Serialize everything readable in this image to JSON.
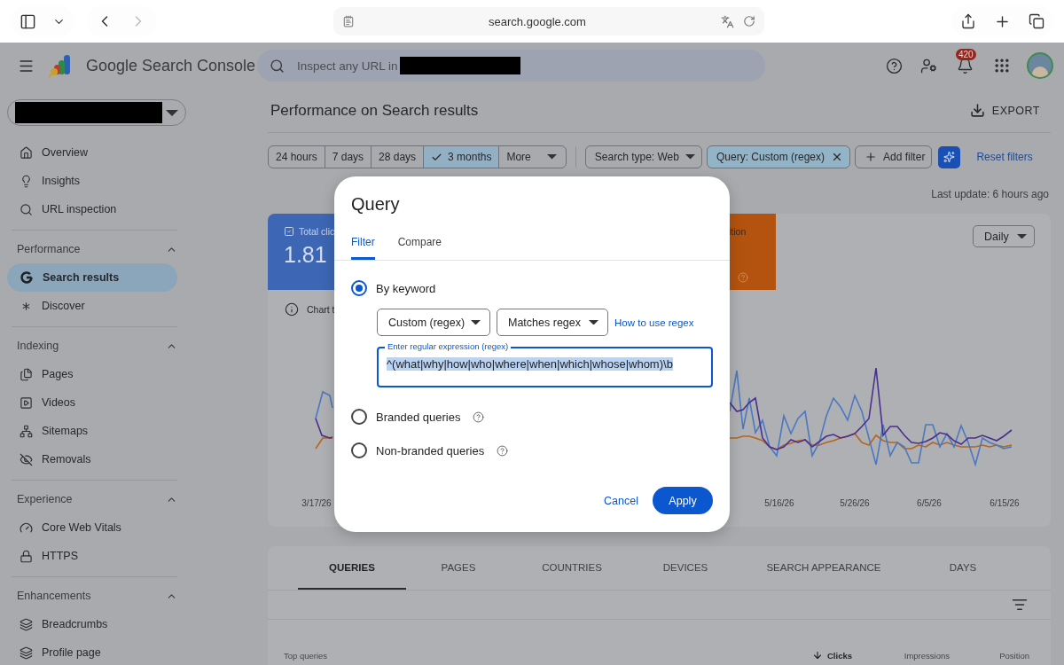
{
  "browser": {
    "address": "search.google.com",
    "back_disabled": false,
    "forward_disabled": true
  },
  "app": {
    "title": "Google Search Console",
    "search_placeholder": "Inspect any URL in",
    "notification_count": "420"
  },
  "sidebar": {
    "items": [
      {
        "kind": "overview",
        "label": "Overview",
        "selected": false
      },
      {
        "kind": "insights",
        "label": "Insights",
        "selected": false
      },
      {
        "kind": "inspect",
        "label": "URL inspection",
        "selected": false
      }
    ],
    "sections": [
      {
        "title": "Performance",
        "expanded": true,
        "items": [
          {
            "kind": "google",
            "label": "Search results",
            "selected": true
          },
          {
            "kind": "discover",
            "label": "Discover",
            "selected": false
          }
        ]
      },
      {
        "title": "Indexing",
        "expanded": true,
        "items": [
          {
            "kind": "pages",
            "label": "Pages",
            "selected": false
          },
          {
            "kind": "videos",
            "label": "Videos",
            "selected": false
          },
          {
            "kind": "sitemaps",
            "label": "Sitemaps",
            "selected": false
          },
          {
            "kind": "removals",
            "label": "Removals",
            "selected": false
          }
        ]
      },
      {
        "title": "Experience",
        "expanded": true,
        "items": [
          {
            "kind": "vitals",
            "label": "Core Web Vitals",
            "selected": false
          },
          {
            "kind": "https",
            "label": "HTTPS",
            "selected": false
          }
        ]
      },
      {
        "title": "Enhancements",
        "expanded": true,
        "items": [
          {
            "kind": "breadcrumbs",
            "label": "Breadcrumbs",
            "selected": false
          },
          {
            "kind": "profile",
            "label": "Profile page",
            "selected": false
          }
        ]
      }
    ]
  },
  "page": {
    "title": "Performance on Search results",
    "export": "EXPORT",
    "last_update": "Last update: 6 hours ago"
  },
  "date_ranges": [
    {
      "label": "24 hours",
      "selected": false
    },
    {
      "label": "7 days",
      "selected": false
    },
    {
      "label": "28 days",
      "selected": false
    },
    {
      "label": "3 months",
      "selected": true
    }
  ],
  "more": "More",
  "filters": [
    {
      "kind": "dropdown",
      "label": "Search type: Web",
      "active": false
    },
    {
      "kind": "removable",
      "label": "Query: Custom (regex)",
      "active": true
    },
    {
      "kind": "add",
      "label": "Add filter",
      "active": false
    }
  ],
  "reset_filters": "Reset filters",
  "chart": {
    "metric_cards": [
      {
        "label": "Total clic",
        "value": "1.81",
        "checked": true,
        "color": "#3d66b4"
      },
      {
        "label": "ition",
        "help": true,
        "color": "#b4530f"
      }
    ],
    "interval": "Daily",
    "info_text": "Chart t",
    "x_labels": [
      {
        "label": "3/17/26"
      },
      {
        "label": "5/16/26"
      },
      {
        "label": "5/26/26"
      },
      {
        "label": "6/5/26"
      },
      {
        "label": "6/15/26"
      }
    ]
  },
  "dialog": {
    "title": "Query",
    "tabs": [
      {
        "label": "Filter",
        "selected": true
      },
      {
        "label": "Compare",
        "selected": false
      }
    ],
    "options": [
      {
        "label": "By keyword",
        "selected": true,
        "help": false
      },
      {
        "label": "Branded queries",
        "selected": false,
        "help": true
      },
      {
        "label": "Non-branded queries",
        "selected": false,
        "help": true
      }
    ],
    "selects": [
      "Custom (regex)",
      "Matches regex"
    ],
    "regex_link": "How to use regex",
    "field": {
      "label": "Enter regular expression (regex)",
      "value": "^(what|why|how|who|where|when|which|whose|whom)\\b",
      "text_selected": true
    },
    "cancel": "Cancel",
    "apply": "Apply"
  },
  "report_tabs": [
    {
      "label": "QUERIES",
      "selected": true
    },
    {
      "label": "PAGES",
      "selected": false
    },
    {
      "label": "COUNTRIES",
      "selected": false
    },
    {
      "label": "DEVICES",
      "selected": false
    },
    {
      "label": "SEARCH APPEARANCE",
      "selected": false
    },
    {
      "label": "DAYS",
      "selected": false
    }
  ],
  "table": {
    "columns": [
      {
        "label": "Top queries",
        "sorted": false
      },
      {
        "label": "Clicks",
        "sorted": true
      },
      {
        "label": "Impressions",
        "sorted": false
      },
      {
        "label": "Position",
        "sorted": false
      }
    ]
  }
}
